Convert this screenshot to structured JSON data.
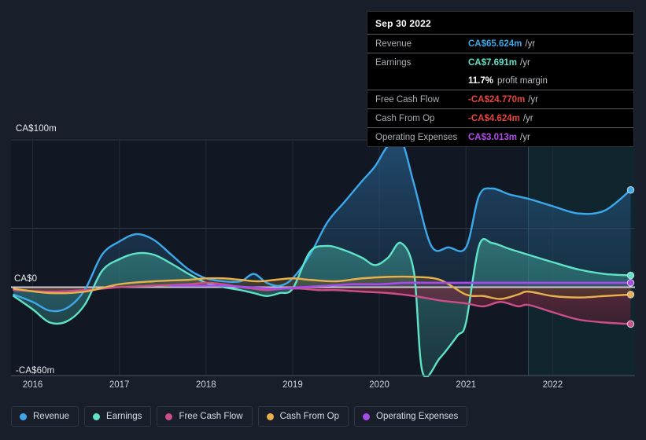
{
  "chart_data": {
    "type": "area",
    "title": "",
    "xlabel": "",
    "ylabel": "",
    "currency": "CA$",
    "ylim": [
      -60,
      100
    ],
    "xlim": [
      2015.75,
      2022.95
    ],
    "grid": true,
    "legend_position": "bottom-left",
    "y_ticks": [
      {
        "value": 100,
        "label": "CA$100m"
      },
      {
        "value": 0,
        "label": "CA$0"
      },
      {
        "value": -60,
        "label": "-CA$60m"
      }
    ],
    "y_gridlines": [
      100,
      40,
      0,
      -60
    ],
    "x_ticks": [
      {
        "value": 2016,
        "label": "2016"
      },
      {
        "value": 2017,
        "label": "2017"
      },
      {
        "value": 2018,
        "label": "2018"
      },
      {
        "value": 2019,
        "label": "2019"
      },
      {
        "value": 2020,
        "label": "2020"
      },
      {
        "value": 2021,
        "label": "2021"
      },
      {
        "value": 2022,
        "label": "2022"
      }
    ],
    "forecast_region_start": 2021.72,
    "series": [
      {
        "name": "Revenue",
        "color": "#3ba9eb",
        "fill": "#1d4160",
        "end_value": 65.624,
        "x": [
          2015.78,
          2016.0,
          2016.2,
          2016.4,
          2016.6,
          2016.8,
          2017.0,
          2017.2,
          2017.4,
          2017.6,
          2017.8,
          2018.0,
          2018.2,
          2018.4,
          2018.55,
          2018.7,
          2018.85,
          2019.0,
          2019.2,
          2019.4,
          2019.6,
          2019.8,
          2019.95,
          2020.1,
          2020.25,
          2020.4,
          2020.6,
          2020.8,
          2021.0,
          2021.15,
          2021.3,
          2021.5,
          2021.72,
          2022.0,
          2022.3,
          2022.6,
          2022.9
        ],
        "y": [
          -5,
          -10,
          -16,
          -14,
          -2,
          22,
          31,
          36,
          32,
          22,
          12,
          6,
          4,
          4,
          9,
          3,
          1,
          6,
          22,
          44,
          58,
          72,
          82,
          96,
          100,
          70,
          28,
          27,
          27,
          62,
          67,
          63,
          60,
          55,
          50,
          52,
          66
        ]
      },
      {
        "name": "Earnings",
        "color": "#5fe3c8",
        "fill": "#2b6a6d",
        "end_value": 7.691,
        "x": [
          2015.78,
          2016.0,
          2016.2,
          2016.4,
          2016.6,
          2016.8,
          2017.0,
          2017.2,
          2017.4,
          2017.6,
          2017.8,
          2018.0,
          2018.2,
          2018.4,
          2018.55,
          2018.7,
          2018.85,
          2019.0,
          2019.2,
          2019.4,
          2019.6,
          2019.8,
          2019.95,
          2020.1,
          2020.25,
          2020.4,
          2020.5,
          2020.7,
          2020.9,
          2021.0,
          2021.15,
          2021.3,
          2021.5,
          2021.72,
          2022.0,
          2022.3,
          2022.6,
          2022.9
        ],
        "y": [
          -6,
          -15,
          -24,
          -23,
          -12,
          11,
          19,
          23,
          22,
          16,
          9,
          3,
          0,
          -2,
          -4,
          -6,
          -4,
          -1,
          24,
          28,
          25,
          20,
          15,
          20,
          30,
          10,
          -58,
          -48,
          -33,
          -24,
          28,
          30,
          26,
          22,
          17,
          12,
          9,
          8
        ]
      },
      {
        "name": "Free Cash Flow",
        "color": "#cc4f8c",
        "fill": "#5a2033",
        "end_value": -24.77,
        "x": [
          2015.78,
          2016.2,
          2016.6,
          2017.0,
          2017.4,
          2017.8,
          2018.0,
          2018.2,
          2018.4,
          2018.55,
          2018.7,
          2018.9,
          2019.1,
          2019.3,
          2019.5,
          2019.8,
          2020.1,
          2020.4,
          2020.7,
          2021.0,
          2021.2,
          2021.4,
          2021.6,
          2021.72,
          2022.0,
          2022.3,
          2022.6,
          2022.9
        ],
        "y": [
          -2,
          -3,
          -2,
          0,
          1,
          2,
          3,
          2,
          0,
          -1,
          -2,
          -1,
          -1,
          -2,
          -2,
          -3,
          -4,
          -6,
          -9,
          -11,
          -13,
          -10,
          -13,
          -12,
          -17,
          -22,
          -24,
          -25
        ]
      },
      {
        "name": "Cash From Op",
        "color": "#e8b14c",
        "fill": "#4a3a22",
        "end_value": -4.624,
        "x": [
          2015.78,
          2016.2,
          2016.6,
          2017.0,
          2017.4,
          2017.8,
          2018.0,
          2018.2,
          2018.4,
          2018.6,
          2018.8,
          2019.0,
          2019.2,
          2019.5,
          2019.8,
          2020.1,
          2020.4,
          2020.7,
          2021.0,
          2021.2,
          2021.4,
          2021.6,
          2021.72,
          2022.0,
          2022.3,
          2022.6,
          2022.9
        ],
        "y": [
          -1,
          -4,
          -3,
          2,
          4,
          5,
          6,
          6,
          5,
          4,
          5,
          6,
          5,
          4,
          6,
          7,
          7,
          5,
          -5,
          -6,
          -8,
          -5,
          -3,
          -6,
          -7,
          -6,
          -5
        ]
      },
      {
        "name": "Operating Expenses",
        "color": "#a84beb",
        "fill": "#3c2a5a",
        "end_value": 3.013,
        "x": [
          2017.6,
          2017.9,
          2018.2,
          2018.5,
          2018.8,
          2019.1,
          2019.4,
          2019.7,
          2020.0,
          2020.3,
          2020.6,
          2020.9,
          2021.2,
          2021.5,
          2021.72,
          2022.0,
          2022.4,
          2022.9
        ],
        "y": [
          1,
          1,
          1,
          0,
          -1,
          0,
          1,
          2,
          2,
          3,
          3,
          3,
          3,
          3,
          3,
          3,
          3,
          3
        ]
      }
    ]
  },
  "tooltip": {
    "date": "Sep 30 2022",
    "rows": [
      {
        "label": "Revenue",
        "value": "CA$65.624m",
        "unit": "/yr",
        "color": "#3ba9eb"
      },
      {
        "label": "Earnings",
        "value": "CA$7.691m",
        "unit": "/yr",
        "color": "#5fe3c8"
      },
      {
        "label": "",
        "value": "11.7%",
        "unit": "profit margin",
        "color": "#ffffff"
      },
      {
        "label": "Free Cash Flow",
        "value": "-CA$24.770m",
        "unit": "/yr",
        "color": "#e8453c"
      },
      {
        "label": "Cash From Op",
        "value": "-CA$4.624m",
        "unit": "/yr",
        "color": "#e8453c"
      },
      {
        "label": "Operating Expenses",
        "value": "CA$3.013m",
        "unit": "/yr",
        "color": "#b44beb"
      }
    ]
  },
  "legend": {
    "items": [
      {
        "label": "Revenue",
        "color": "#3ba9eb"
      },
      {
        "label": "Earnings",
        "color": "#5fe3c8"
      },
      {
        "label": "Free Cash Flow",
        "color": "#cc4f8c"
      },
      {
        "label": "Cash From Op",
        "color": "#e8b14c"
      },
      {
        "label": "Operating Expenses",
        "color": "#a84beb"
      }
    ]
  }
}
